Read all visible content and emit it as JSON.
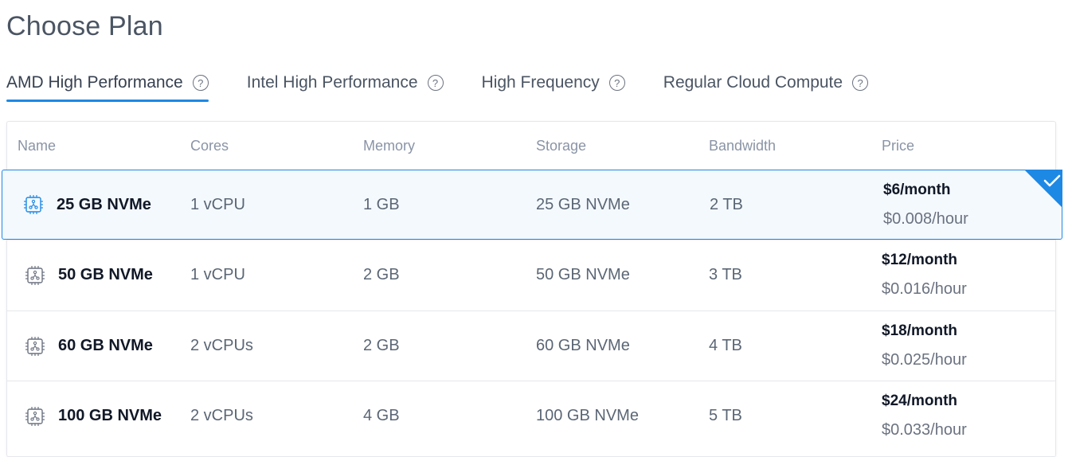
{
  "page": {
    "title": "Choose Plan"
  },
  "tabs": [
    {
      "label": "AMD High Performance",
      "active": true
    },
    {
      "label": "Intel High Performance",
      "active": false
    },
    {
      "label": "High Frequency",
      "active": false
    },
    {
      "label": "Regular Cloud Compute",
      "active": false
    }
  ],
  "table": {
    "headers": [
      "Name",
      "Cores",
      "Memory",
      "Storage",
      "Bandwidth",
      "Price"
    ],
    "rows": [
      {
        "name": "25 GB NVMe",
        "cores": "1 vCPU",
        "memory": "1 GB",
        "storage": "25 GB NVMe",
        "bandwidth": "2 TB",
        "price_month": "$6/month",
        "price_hour": "$0.008/hour",
        "selected": true
      },
      {
        "name": "50 GB NVMe",
        "cores": "1 vCPU",
        "memory": "2 GB",
        "storage": "50 GB NVMe",
        "bandwidth": "3 TB",
        "price_month": "$12/month",
        "price_hour": "$0.016/hour",
        "selected": false
      },
      {
        "name": "60 GB NVMe",
        "cores": "2 vCPUs",
        "memory": "2 GB",
        "storage": "60 GB NVMe",
        "bandwidth": "4 TB",
        "price_month": "$18/month",
        "price_hour": "$0.025/hour",
        "selected": false
      },
      {
        "name": "100 GB NVMe",
        "cores": "2 vCPUs",
        "memory": "4 GB",
        "storage": "100 GB NVMe",
        "bandwidth": "5 TB",
        "price_month": "$24/month",
        "price_hour": "$0.033/hour",
        "selected": false
      }
    ]
  },
  "icons": {
    "tab_help": "help-circle-icon",
    "plan": "cpu-chip-icon",
    "selected": "checkmark-corner-icon"
  },
  "colors": {
    "accent": "#1e88e5",
    "selected_bg": "#f4f9fe"
  }
}
